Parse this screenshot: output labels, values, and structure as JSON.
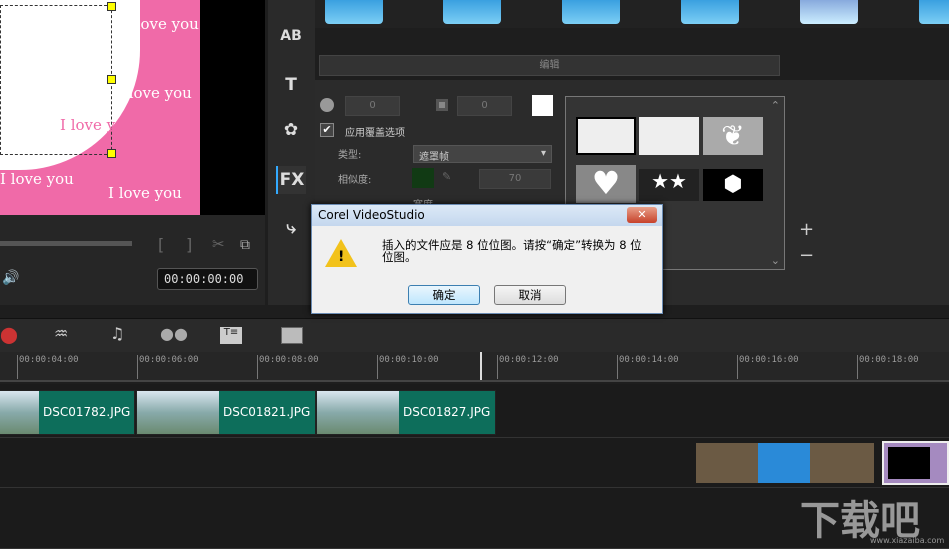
{
  "preview": {
    "texts": [
      "I love you",
      "I love you",
      "I love you",
      "I love you",
      "I love you"
    ],
    "timecode": "00:00:00:00"
  },
  "side_icons": [
    "AB",
    "T",
    "flower",
    "FX",
    "path"
  ],
  "edit_tab": "编辑",
  "options": {
    "value1": "0",
    "value2": "0",
    "apply_overlay": "应用覆盖选项",
    "type_label": "类型:",
    "type_value": "遮罩帧",
    "similarity_label": "相似度:",
    "similarity_value": "70",
    "width_label": "宽度"
  },
  "dialog": {
    "title": "Corel VideoStudio",
    "close": "✕",
    "message": "插入的文件应是 8 位位图。请按“确定”转换为 8 位位图。",
    "ok": "确定",
    "cancel": "取消"
  },
  "ruler": [
    "00:00:04:00",
    "00:00:06:00",
    "00:00:08:00",
    "00:00:10:00",
    "00:00:12:00",
    "00:00:14:00",
    "00:00:16:00",
    "00:00:18:00"
  ],
  "clips": [
    "DSC01782.JPG",
    "DSC01821.JPG",
    "DSC01827.JPG"
  ],
  "watermark": "下载吧 www.xiazaiba.com"
}
